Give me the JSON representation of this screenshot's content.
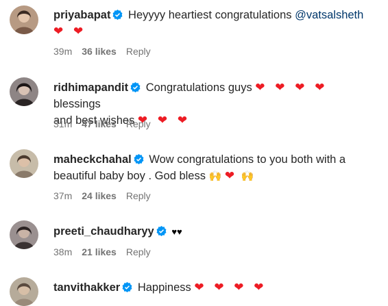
{
  "comments": [
    {
      "username": "priyabapat",
      "text": "Heyyyy heartiest congratulations",
      "mention": "@vatsalsheth",
      "line2": "❤ ❤",
      "time": "39m",
      "likes": "36 likes",
      "reply": "Reply",
      "avatar_color": "#7a5a48"
    },
    {
      "username": "ridhimapandit",
      "text": "Congratulations guys",
      "hearts": "❤ ❤ ❤ ❤",
      "text_after": "blessings",
      "line2": "and best wishes",
      "hearts2": "❤ ❤ ❤",
      "time": "31m",
      "likes": "47 likes",
      "reply": "Reply",
      "avatar_color": "#3d3535"
    },
    {
      "username": "maheckchahal",
      "text": "Wow congratulations to you both with a",
      "line2": "beautiful baby boy . God bless",
      "emoji_raise": "🙌",
      "heart": "❤",
      "time": "37m",
      "likes": "24 likes",
      "reply": "Reply",
      "avatar_color": "#8a7a6a"
    },
    {
      "username": "preeti_chaudharyy",
      "black_hearts": "♥♥",
      "time": "38m",
      "likes": "21 likes",
      "reply": "Reply",
      "avatar_color": "#6a6060"
    },
    {
      "username": "tanvithakker",
      "text": "Happiness",
      "hearts": "❤ ❤ ❤ ❤",
      "avatar_color": "#9a8a7a"
    }
  ],
  "colors": {
    "verified": "#0095f6",
    "heart": "#ed1c24",
    "meta": "#737373",
    "mention": "#00376b"
  }
}
